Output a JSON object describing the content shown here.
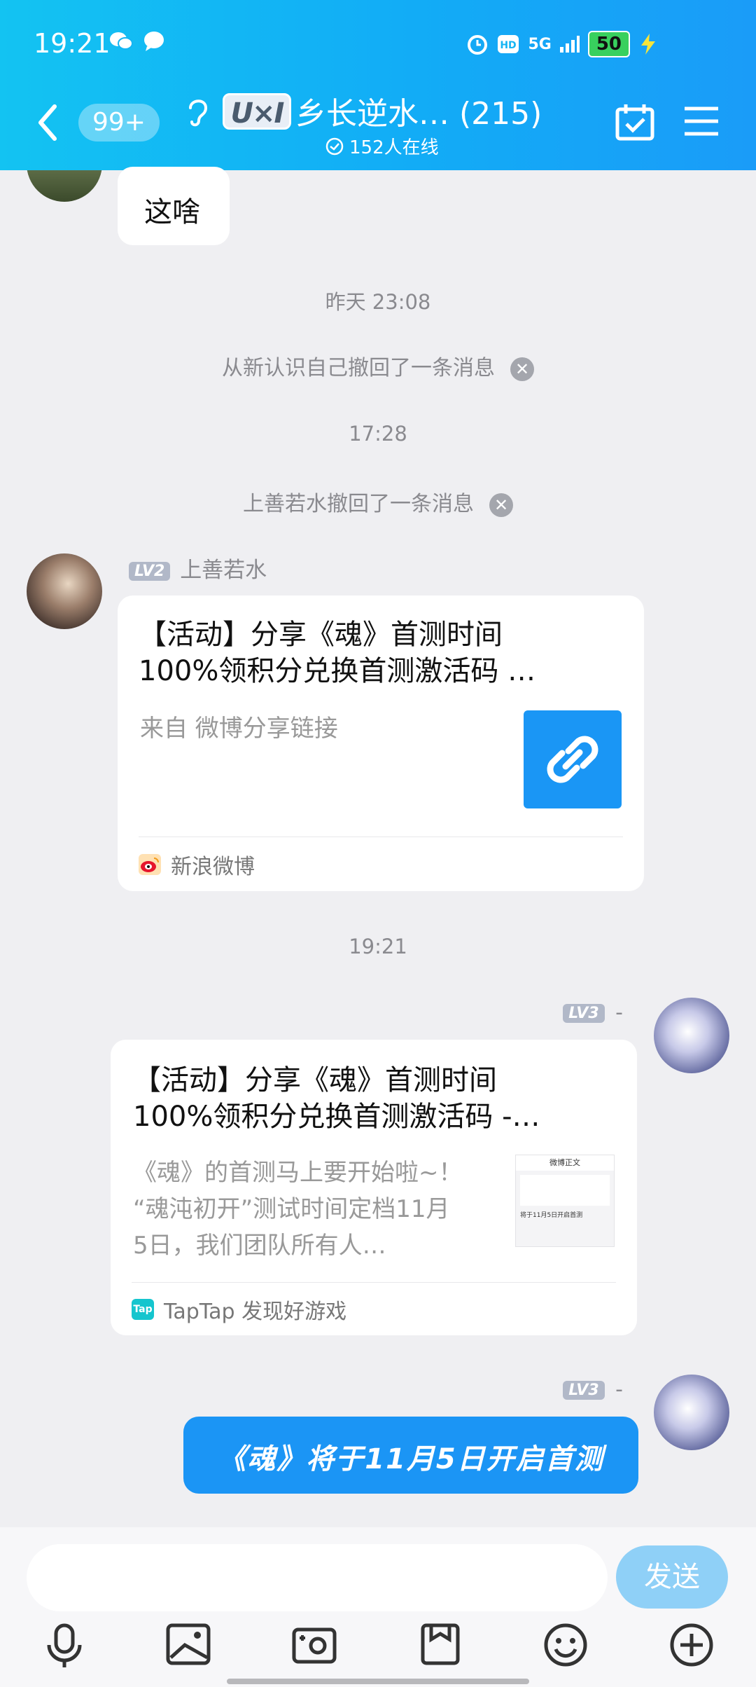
{
  "status_bar": {
    "time": "19:21",
    "network": "5G",
    "battery": "50"
  },
  "header": {
    "unread_badge": "99+",
    "group_logo": "U×I",
    "group_title": "乡长逆水… (215)",
    "online_count": "152人在线"
  },
  "messages": {
    "top_bubble_text": "这啥",
    "timestamp_1": "昨天 23:08",
    "recall_1": "从新认识自己撤回了一条消息",
    "timestamp_2": "17:28",
    "recall_2": "上善若水撤回了一条消息",
    "sender_lv": "LV2",
    "sender_name": "上善若水",
    "card1": {
      "title_line1": "【活动】分享《魂》首测时间",
      "title_line2": "100%领积分兑换首测激活码 …",
      "source": "来自 微博分享链接",
      "footer": "新浪微博"
    },
    "timestamp_3": "19:21",
    "self_lv": "LV3",
    "self_name": "-",
    "card2": {
      "title_line1": "【活动】分享《魂》首测时间",
      "title_line2": "100%领积分兑换首测激活码 -…",
      "desc_line1": "《魂》的首测马上要开始啦~！",
      "desc_line2": "“魂沌初开”测试时间定档11月",
      "desc_line3": "5日，我们团队所有人…",
      "thumb_header": "微博正文",
      "thumb_caption": "将于11月5日开启首测",
      "footer": "TapTap 发现好游戏",
      "footer_badge": "Tap"
    },
    "self_lv_2": "LV3",
    "self_name_2": "-",
    "blue_bubble_text": "《魂》将于11月5日开启首测"
  },
  "input": {
    "send_label": "发送"
  },
  "toolbar": [
    "microphone-icon",
    "image-icon",
    "camera-icon",
    "file-icon",
    "emoji-icon",
    "plus-icon"
  ]
}
